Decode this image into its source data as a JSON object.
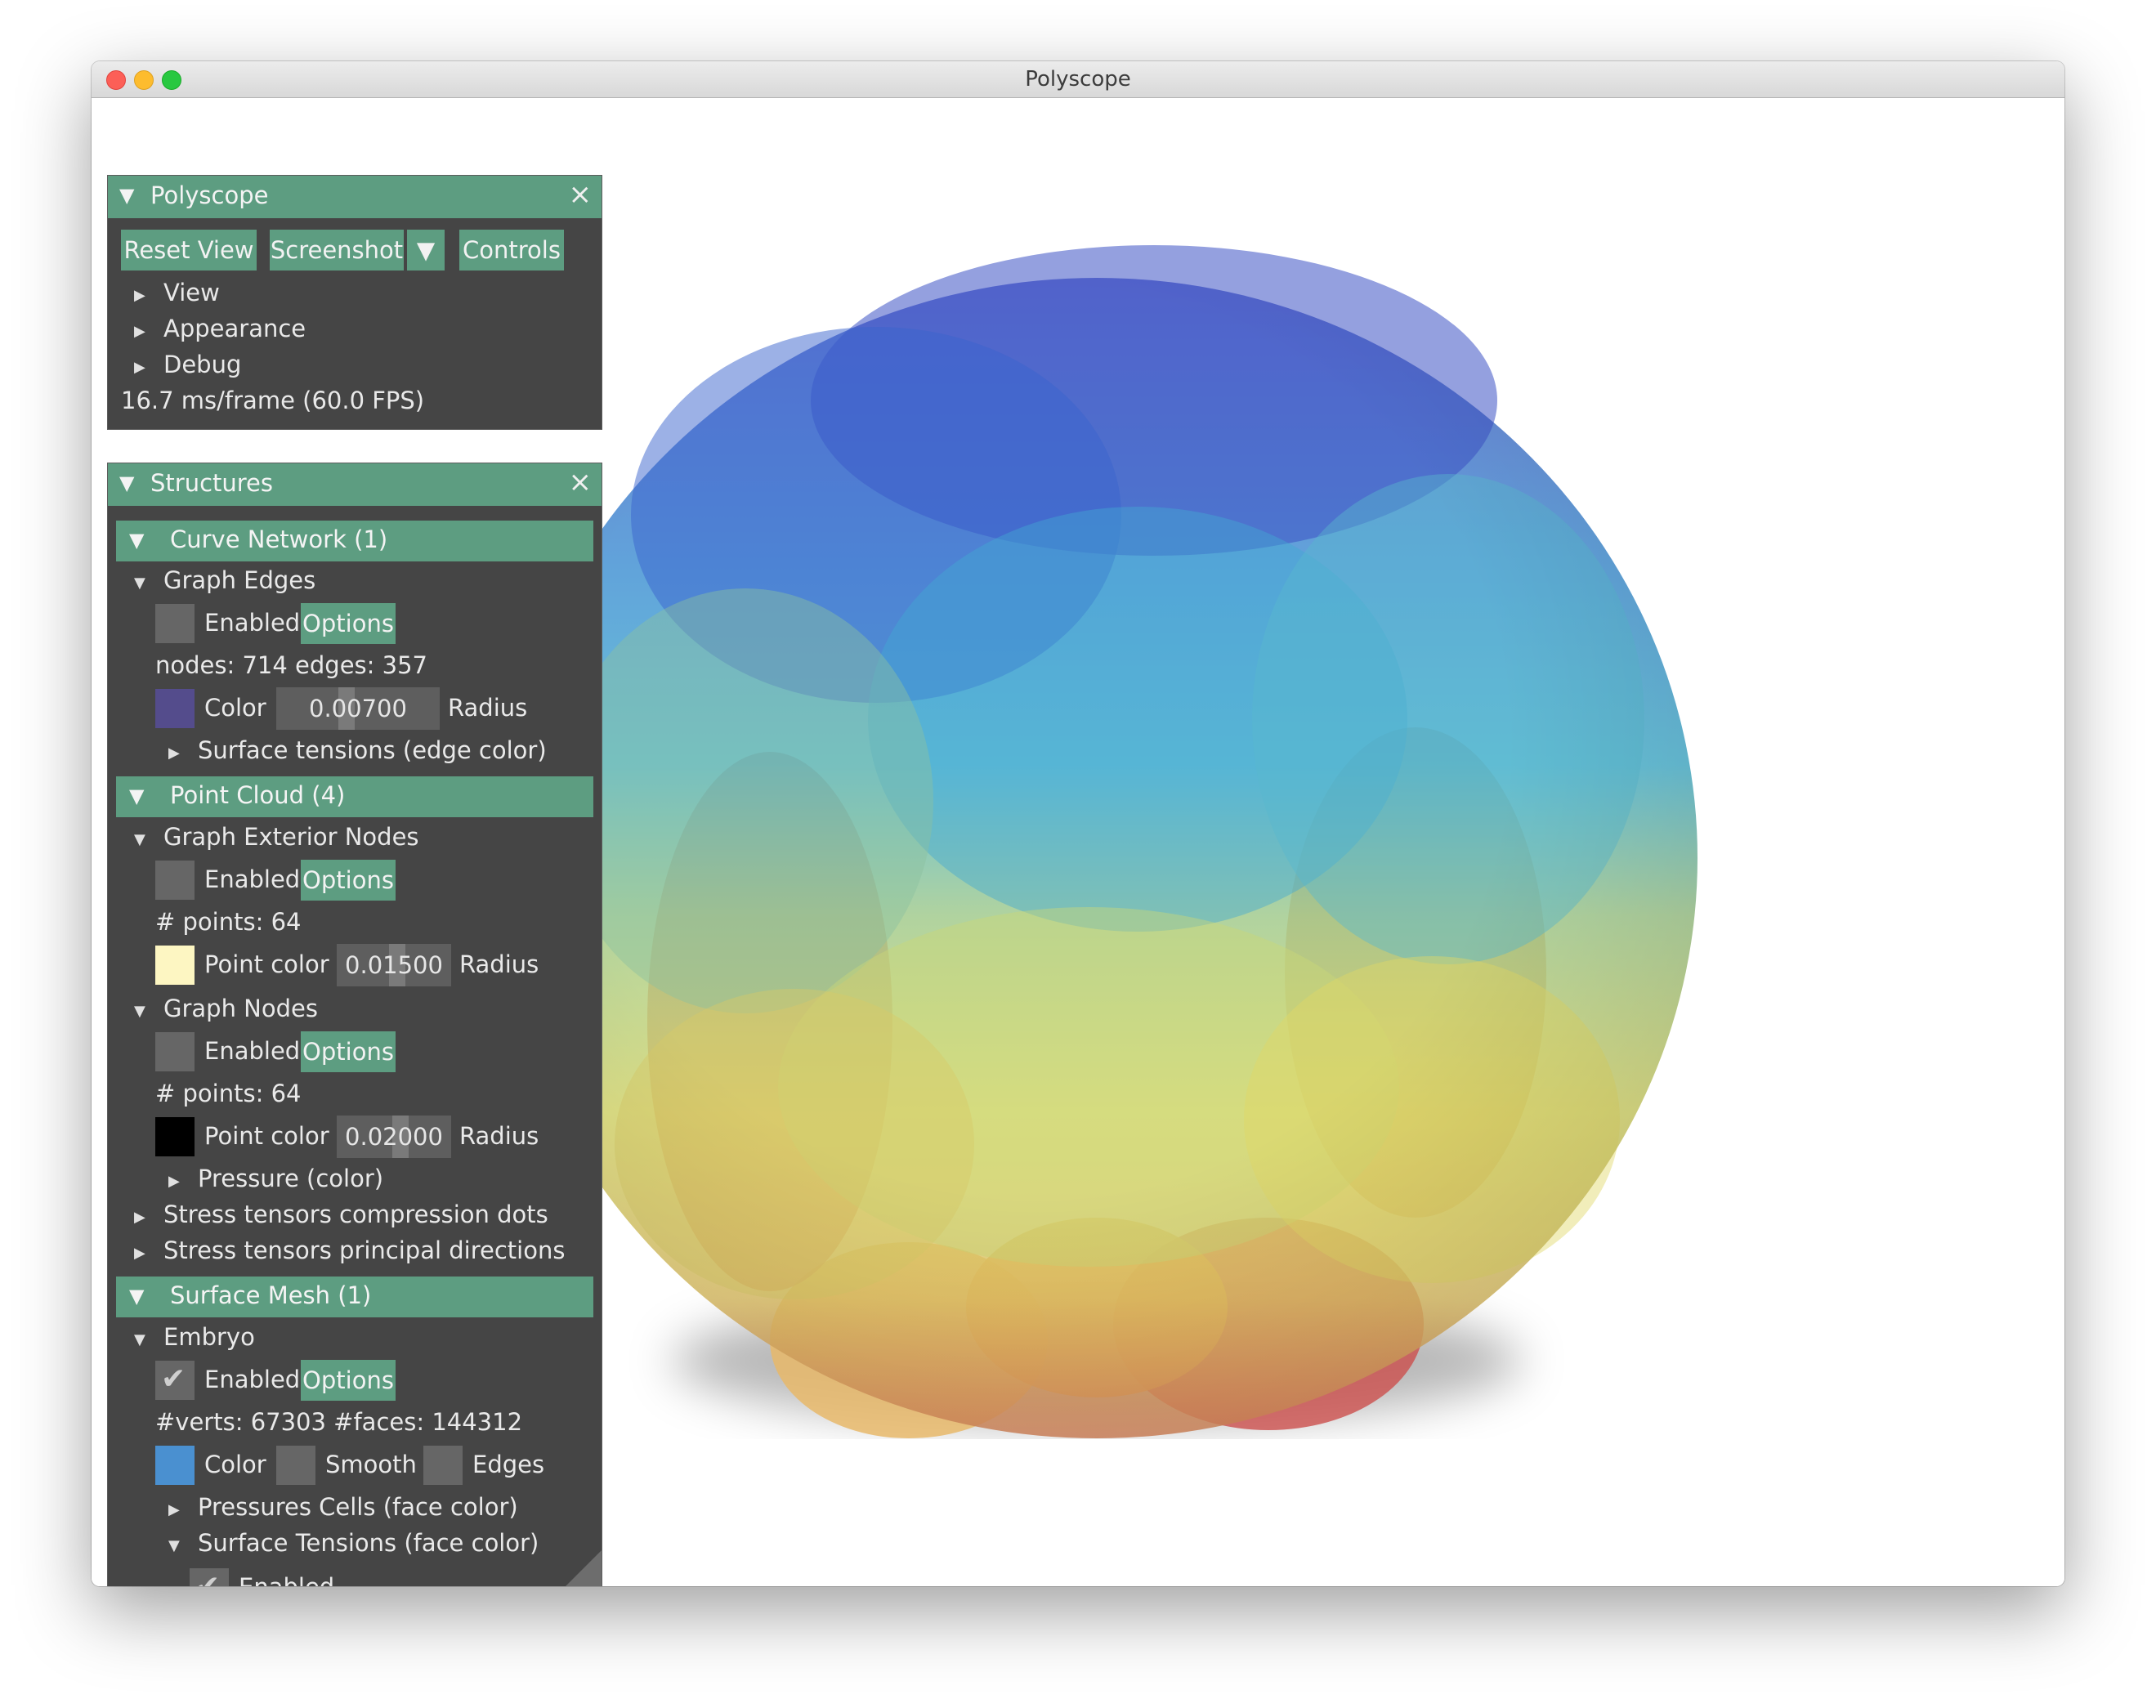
{
  "window": {
    "title": "Polyscope"
  },
  "main_panel": {
    "title": "Polyscope",
    "buttons": {
      "reset_view": "Reset View",
      "screenshot": "Screenshot",
      "controls": "Controls"
    },
    "items": [
      "View",
      "Appearance",
      "Debug"
    ],
    "fps": "16.7 ms/frame (60.0 FPS)"
  },
  "structures_panel": {
    "title": "Structures",
    "curve_network": {
      "header": "Curve Network (1)",
      "item": "Graph Edges",
      "enabled_label": "Enabled",
      "options_label": "Options",
      "stats": "nodes: 714  edges: 357",
      "color_label": "Color",
      "color": "#544c8c",
      "radius_value": "0.00700",
      "radius_label": "Radius",
      "quantity": "Surface tensions (edge color)"
    },
    "point_cloud": {
      "header": "Point Cloud (4)",
      "exterior": {
        "item": "Graph Exterior Nodes",
        "enabled_label": "Enabled",
        "options_label": "Options",
        "stats": "# points: 64",
        "color_label": "Point color",
        "color": "#fdf6c2",
        "radius_value": "0.01500",
        "radius_label": "Radius"
      },
      "nodes": {
        "item": "Graph Nodes",
        "enabled_label": "Enabled",
        "options_label": "Options",
        "stats": "# points: 64",
        "color_label": "Point color",
        "color": "#000000",
        "radius_value": "0.02000",
        "radius_label": "Radius",
        "quantity": "Pressure (color)"
      },
      "extra_items": [
        "Stress tensors compression dots",
        "Stress tensors principal directions"
      ]
    },
    "surface_mesh": {
      "header": "Surface Mesh (1)",
      "item": "Embryo",
      "enabled_label": "Enabled",
      "options_label": "Options",
      "stats": "#verts: 67303  #faces: 144312",
      "color_label": "Color",
      "color": "#4a90d0",
      "smooth_label": "Smooth",
      "edges_label": "Edges",
      "quantities": [
        "Pressures Cells (face color)",
        "Surface Tensions (face color)"
      ],
      "quantity_enabled_label": "Enabled"
    }
  },
  "icons": {
    "collapse": "triangle-down-icon",
    "expand": "triangle-right-icon",
    "close": "close-icon",
    "check": "checkmark-icon"
  },
  "colors": {
    "panel_bg": "#454545",
    "accent": "#5d9d81"
  }
}
